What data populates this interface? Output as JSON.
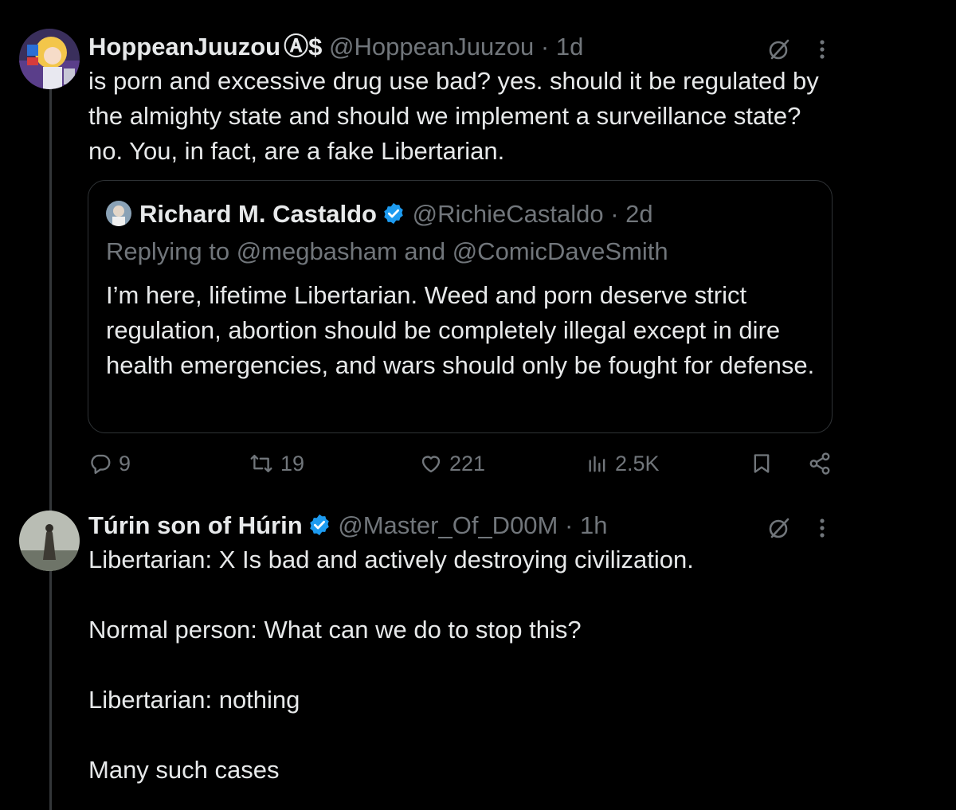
{
  "tweet1": {
    "name": "HoppeanJuuzou",
    "symbols": "Ⓐ$",
    "handle": "@HoppeanJuuzou",
    "dot": "·",
    "time": "1d",
    "text": "is porn and excessive drug use bad? yes. should it be regulated by the almighty state and should we implement a surveillance state? no. You, in fact, are a fake Libertarian.",
    "quote": {
      "name": "Richard M. Castaldo",
      "handle": "@RichieCastaldo",
      "dot": "·",
      "time": "2d",
      "replying": "Replying to @megbasham and @ComicDaveSmith",
      "text": "I’m here, lifetime Libertarian. Weed and porn deserve strict regulation, abortion should be completely illegal except in dire health emergencies, and wars should only be fought for defense."
    },
    "actions": {
      "replies": "9",
      "retweets": "19",
      "likes": "221",
      "views": "2.5K"
    }
  },
  "tweet2": {
    "name": "Túrin son of Húrin",
    "handle": "@Master_Of_D00M",
    "dot": "·",
    "time": "1h",
    "text": "Libertarian: X Is bad and actively destroying civilization.\n\nNormal person: What can we do to stop this?\n\nLibertarian: nothing\n\nMany such cases"
  },
  "colors": {
    "background": "#000000",
    "text": "#e7e9ea",
    "muted": "#71767b",
    "verified": "#1d9bf0",
    "border": "#2f3336"
  },
  "icons": [
    "grok-icon",
    "more-icon",
    "reply-icon",
    "retweet-icon",
    "like-icon",
    "views-icon",
    "bookmark-icon",
    "share-icon",
    "verified-badge-icon"
  ]
}
